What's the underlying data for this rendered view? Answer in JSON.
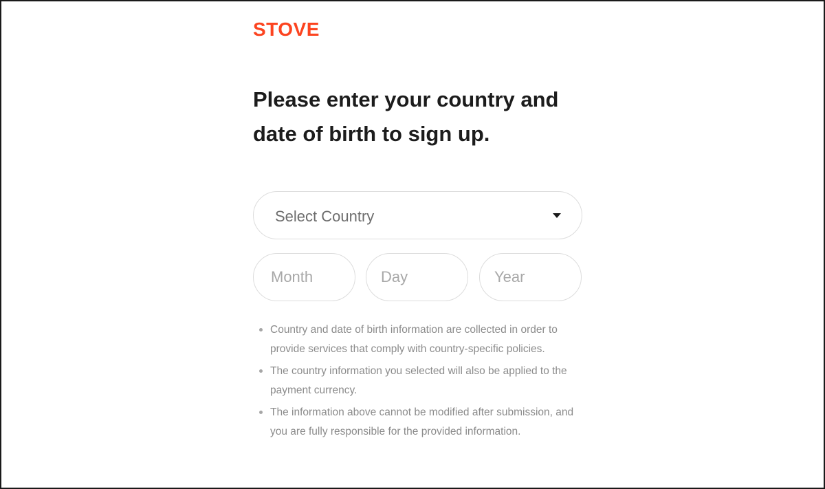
{
  "brand": {
    "logo_text": "STOVE",
    "color": "#fc4420"
  },
  "page": {
    "heading": "Please enter your country and date of birth to sign up."
  },
  "form": {
    "country_select": {
      "placeholder": "Select Country",
      "icon": "caret-down-icon"
    },
    "month": {
      "placeholder": "Month",
      "value": ""
    },
    "day": {
      "placeholder": "Day",
      "value": ""
    },
    "year": {
      "placeholder": "Year",
      "value": ""
    }
  },
  "notes": [
    "Country and date of birth information are collected in order to provide services that comply with country-specific policies.",
    "The country information you selected will also be applied to the payment currency.",
    "The information above cannot be modified after submission, and you are fully responsible for the provided information."
  ]
}
